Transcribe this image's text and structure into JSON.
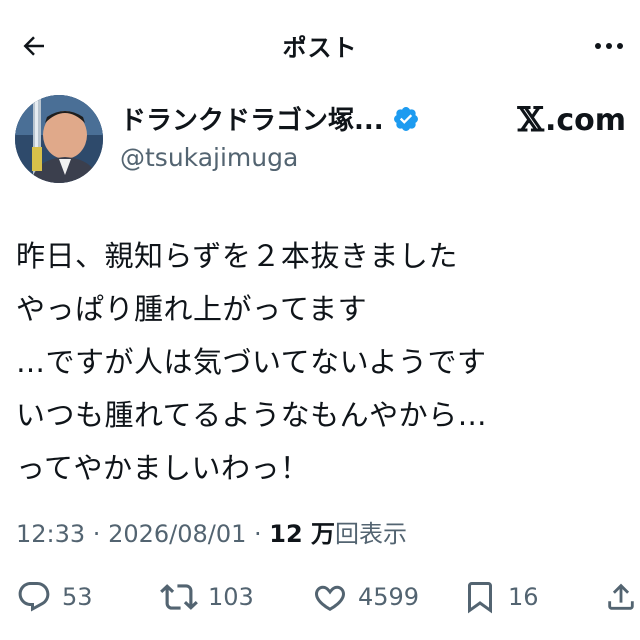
{
  "header": {
    "title": "ポスト"
  },
  "author": {
    "display_name": "ドランクドラゴン塚...",
    "handle": "@tsukajimuga",
    "verified": true,
    "brand_mark": "𝕏",
    "brand_suffix": ".com"
  },
  "tweet": {
    "lines": [
      "昨日、親知らずを２本抜きました",
      "やっぱり腫れ上がってます",
      "…ですが人は気づいてないようです",
      "いつも腫れてるようなもんやから…",
      "ってやかましいわっ！"
    ]
  },
  "meta": {
    "time": "12:33",
    "separator": " · ",
    "date": "2026/08/01",
    "views_number": "12 万",
    "views_label": "回表示"
  },
  "actions": {
    "reply_count": "53",
    "repost_count": "103",
    "like_count": "4599",
    "bookmark_count": "16"
  },
  "colors": {
    "text": "#0f1419",
    "secondary": "#536471",
    "verified_blue": "#1d9bf0"
  },
  "icons": [
    "back-arrow-icon",
    "more-icon",
    "verified-icon",
    "reply-icon",
    "repost-icon",
    "like-icon",
    "bookmark-icon",
    "share-icon"
  ]
}
